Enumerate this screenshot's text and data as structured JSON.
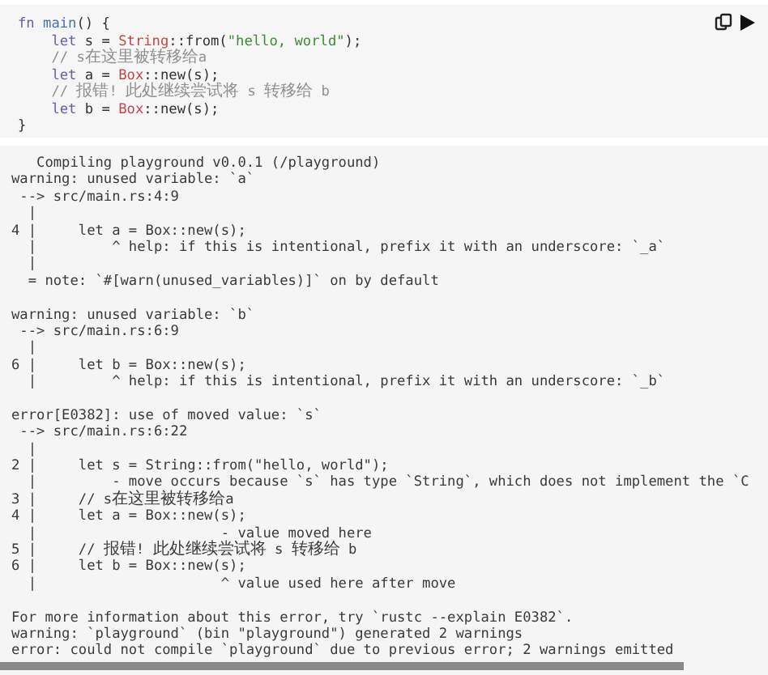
{
  "code": {
    "lines": [
      {
        "indented": false,
        "tokens": [
          {
            "text": "fn ",
            "kind": "keyword"
          },
          {
            "text": "main",
            "kind": "function"
          },
          {
            "text": "() {",
            "kind": "plain"
          }
        ]
      },
      {
        "indented": true,
        "tokens": [
          {
            "text": "let",
            "kind": "keyword"
          },
          {
            "text": " s = ",
            "kind": "plain"
          },
          {
            "text": "String",
            "kind": "type"
          },
          {
            "text": "::from(",
            "kind": "plain"
          },
          {
            "text": "\"hello, world\"",
            "kind": "string"
          },
          {
            "text": ");",
            "kind": "plain"
          }
        ]
      },
      {
        "indented": true,
        "tokens": [
          {
            "text": "// s在这里被转移给a",
            "kind": "comment"
          }
        ]
      },
      {
        "indented": true,
        "tokens": [
          {
            "text": "let",
            "kind": "keyword"
          },
          {
            "text": " a = ",
            "kind": "plain"
          },
          {
            "text": "Box",
            "kind": "type"
          },
          {
            "text": "::new(s);",
            "kind": "plain"
          }
        ]
      },
      {
        "indented": true,
        "tokens": [
          {
            "text": "// 报错! 此处继续尝试将 s 转移给 b",
            "kind": "comment"
          }
        ]
      },
      {
        "indented": true,
        "tokens": [
          {
            "text": "let",
            "kind": "keyword"
          },
          {
            "text": " b = ",
            "kind": "plain"
          },
          {
            "text": "Box",
            "kind": "type"
          },
          {
            "text": "::new(s);",
            "kind": "plain"
          }
        ]
      },
      {
        "indented": false,
        "tokens": [
          {
            "text": "}",
            "kind": "plain"
          }
        ]
      }
    ]
  },
  "output": {
    "blocks": [
      [
        "   Compiling playground v0.0.1 (/playground)",
        "warning: unused variable: `a`",
        " --> src/main.rs:4:9",
        "  |",
        "4 |     let a = Box::new(s);",
        "  |         ^ help: if this is intentional, prefix it with an underscore: `_a`",
        "  |",
        "  = note: `#[warn(unused_variables)]` on by default"
      ],
      [
        "warning: unused variable: `b`",
        " --> src/main.rs:6:9",
        "  |",
        "6 |     let b = Box::new(s);",
        "  |         ^ help: if this is intentional, prefix it with an underscore: `_b`"
      ],
      [
        "error[E0382]: use of moved value: `s`",
        " --> src/main.rs:6:22",
        "  |",
        "2 |     let s = String::from(\"hello, world\");",
        "  |         - move occurs because `s` has type `String`, which does not implement the `C",
        "3 |     // s在这里被转移给a",
        "4 |     let a = Box::new(s);",
        "  |                      - value moved here",
        "5 |     // 报错! 此处继续尝试将 s 转移给 b",
        "6 |     let b = Box::new(s);",
        "  |                      ^ value used here after move"
      ],
      [
        "For more information about this error, try `rustc --explain E0382`.",
        "warning: `playground` (bin \"playground\") generated 2 warnings",
        "error: could not compile `playground` due to previous error; 2 warnings emitted"
      ]
    ]
  }
}
